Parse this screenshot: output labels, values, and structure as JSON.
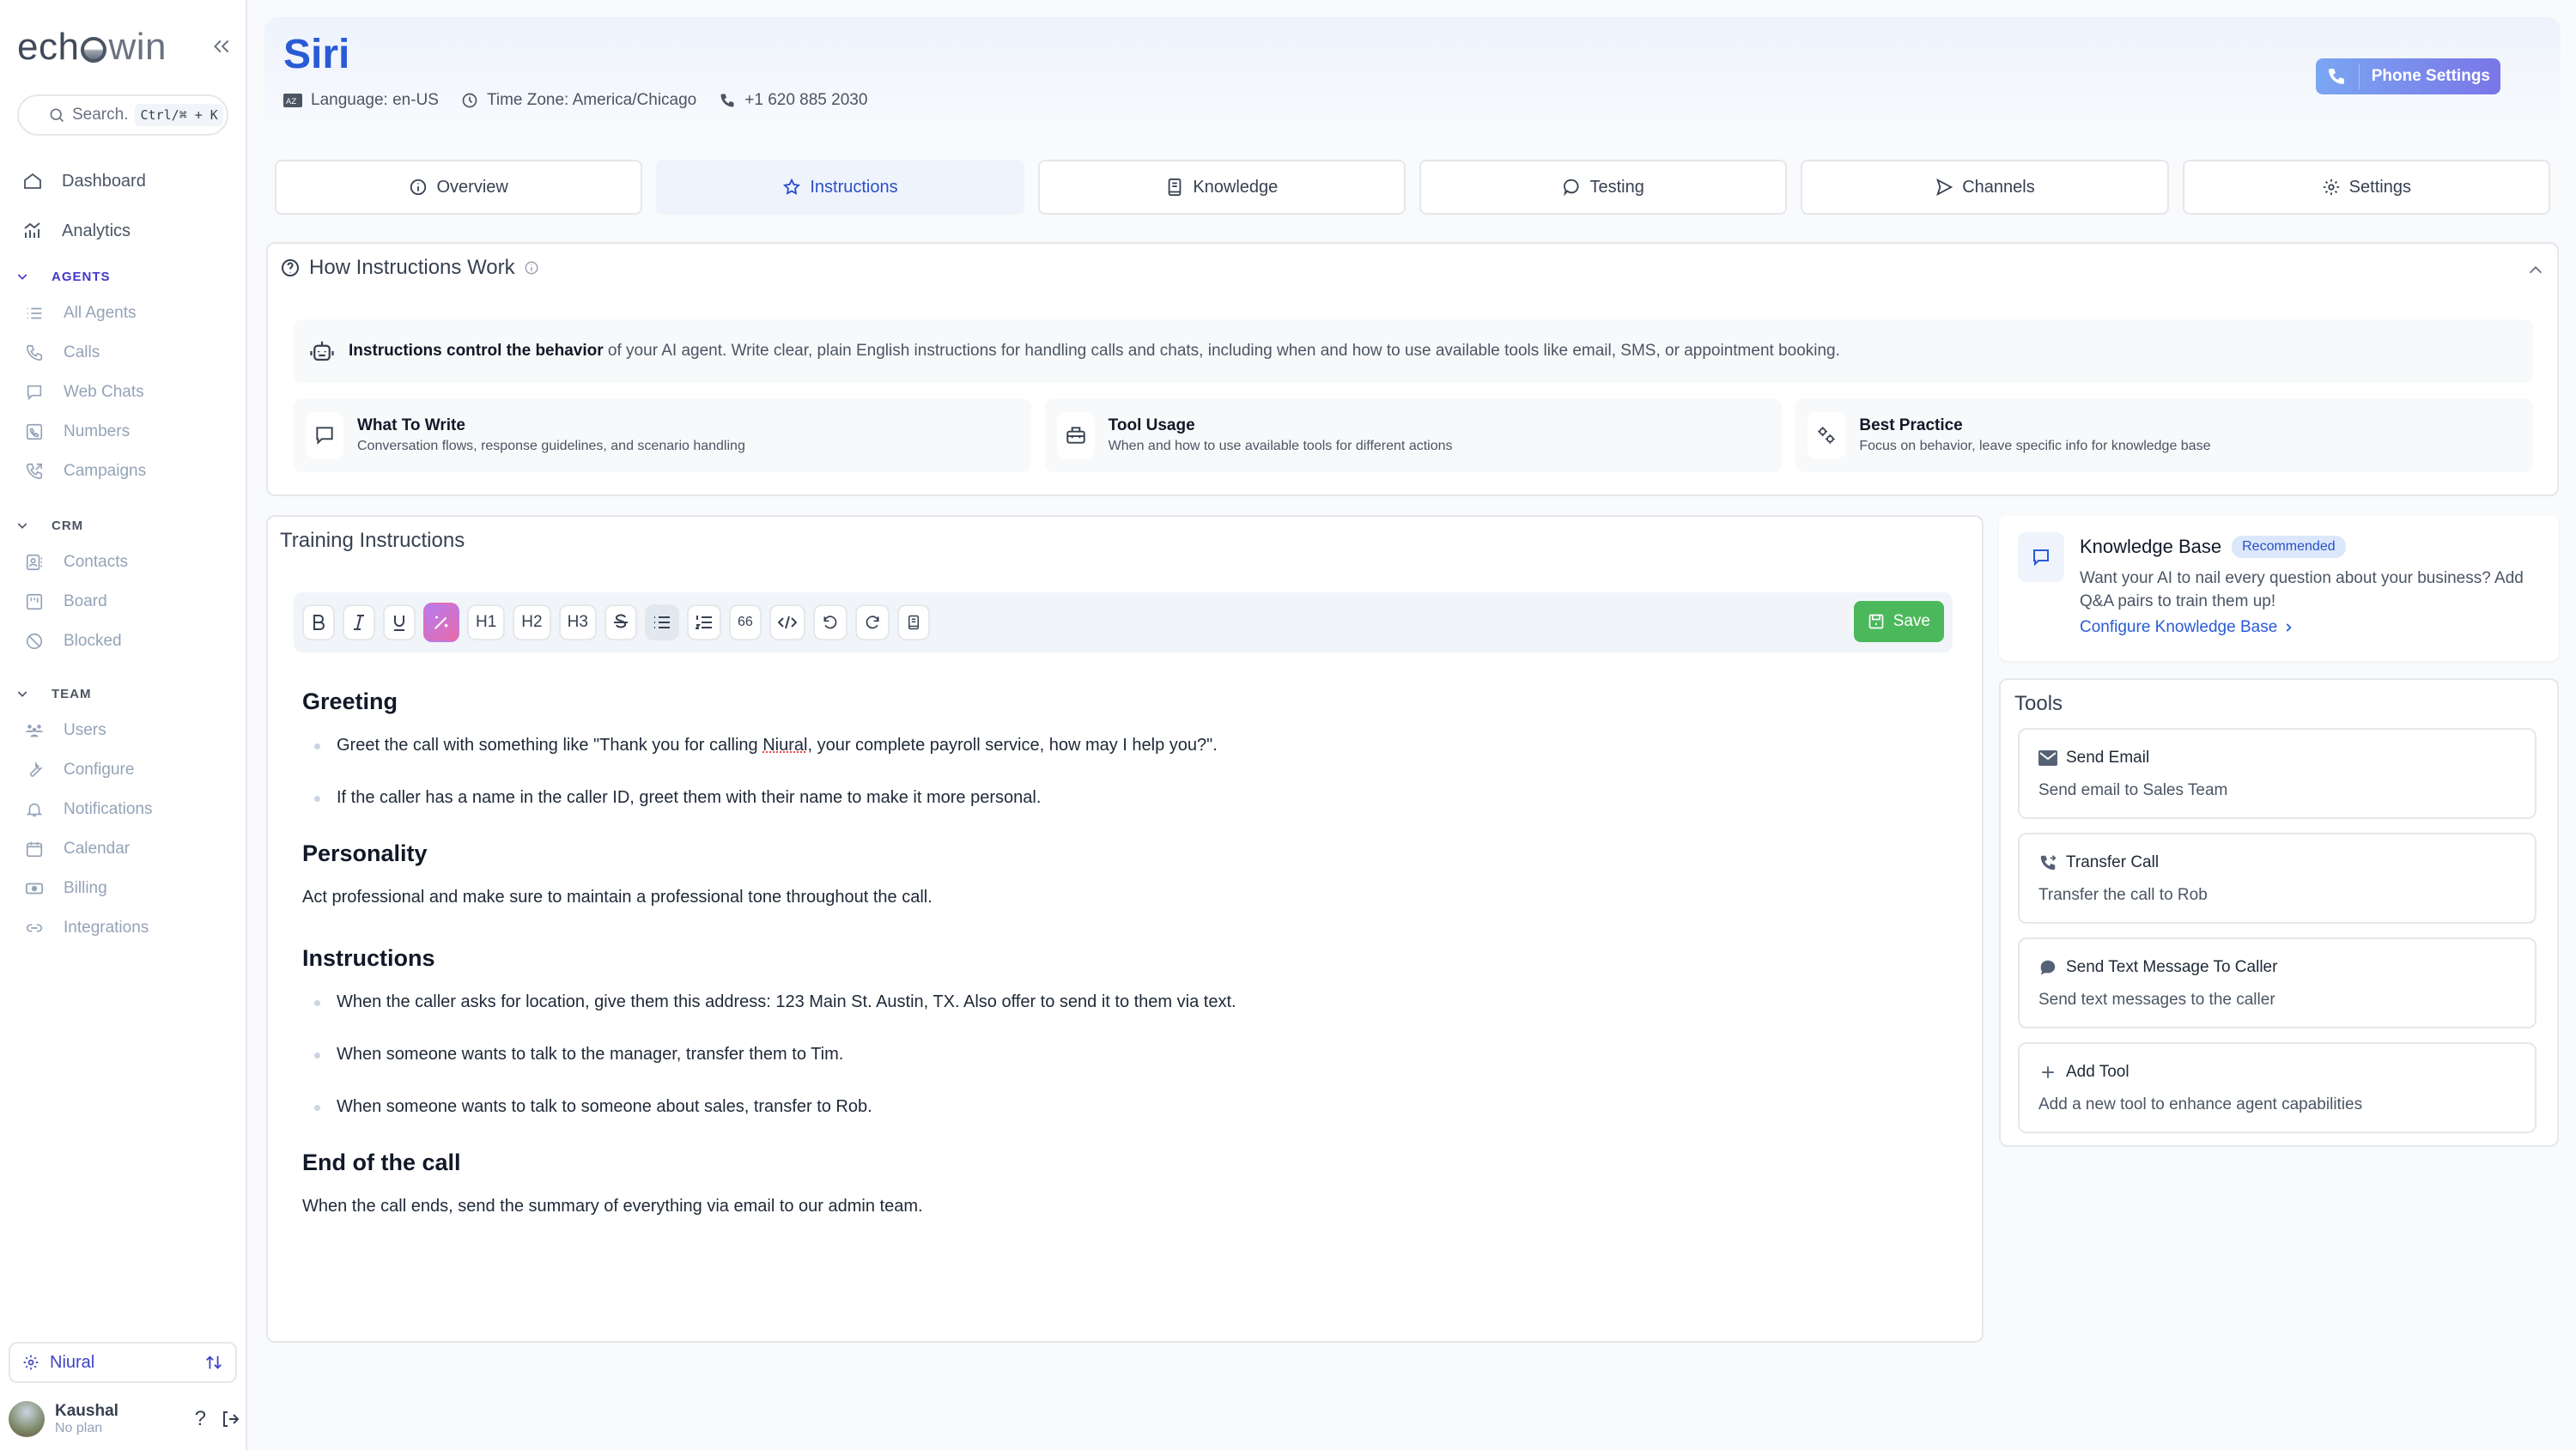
{
  "app": {
    "logo_prefix": "ech",
    "logo_suffix": "win"
  },
  "sidebar": {
    "search_placeholder": "Search.",
    "search_shortcut": "Ctrl/⌘ + K",
    "top_items": [
      {
        "label": "Dashboard",
        "icon": "home-icon"
      },
      {
        "label": "Analytics",
        "icon": "analytics-icon"
      }
    ],
    "sections": [
      {
        "title": "AGENTS",
        "items": [
          "All Agents",
          "Calls",
          "Web Chats",
          "Numbers",
          "Campaigns"
        ]
      },
      {
        "title": "CRM",
        "items": [
          "Contacts",
          "Board",
          "Blocked"
        ]
      },
      {
        "title": "TEAM",
        "items": [
          "Users",
          "Configure",
          "Notifications",
          "Calendar",
          "Billing",
          "Integrations"
        ]
      }
    ],
    "org_name": "Niural",
    "user": {
      "name": "Kaushal",
      "plan": "No plan"
    }
  },
  "header": {
    "title": "Siri",
    "language": "Language: en-US",
    "timezone": "Time Zone: America/Chicago",
    "phone": "+1 620 885 2030",
    "phone_settings_label": "Phone Settings"
  },
  "tabs": [
    {
      "label": "Overview",
      "active": false
    },
    {
      "label": "Instructions",
      "active": true
    },
    {
      "label": "Knowledge",
      "active": false
    },
    {
      "label": "Testing",
      "active": false
    },
    {
      "label": "Channels",
      "active": false
    },
    {
      "label": "Settings",
      "active": false
    }
  ],
  "how": {
    "title": "How Instructions Work",
    "banner_bold": "Instructions control the behavior",
    "banner_rest": " of your AI agent. Write clear, plain English instructions for handling calls and chats, including when and how to use available tools like email, SMS, or appointment booking.",
    "cards": [
      {
        "title": "What To Write",
        "desc": "Conversation flows, response guidelines, and scenario handling"
      },
      {
        "title": "Tool Usage",
        "desc": "When and how to use available tools for different actions"
      },
      {
        "title": "Best Practice",
        "desc": "Focus on behavior, leave specific info for knowledge base"
      }
    ]
  },
  "training": {
    "title": "Training Instructions",
    "toolbar": {
      "h1": "H1",
      "h2": "H2",
      "h3": "H3",
      "quote": "66",
      "save_label": "Save"
    },
    "content": {
      "greeting_heading": "Greeting",
      "greeting_1_pre": "Greet the call with something like \"Thank you for calling ",
      "greeting_1_word": "Niural",
      "greeting_1_post": ", your complete payroll service, how may I help you?\".",
      "greeting_2": "If the caller has a name in the caller ID, greet them with their name to make it more personal.",
      "personality_heading": "Personality",
      "personality_text": "Act professional and make sure to maintain a professional tone throughout the call.",
      "instructions_heading": "Instructions",
      "instructions": [
        "When the caller asks for location, give them this address: 123 Main St. Austin, TX. Also offer to send it to them via text.",
        "When someone wants to talk to the manager, transfer them to Tim.",
        "When someone wants to talk to someone about sales, transfer to Rob."
      ],
      "end_heading": "End of the call",
      "end_text": "When the call ends, send the summary of everything via email to our admin team."
    }
  },
  "knowledge_base": {
    "title": "Knowledge Base",
    "badge": "Recommended",
    "desc": "Want your AI to nail every question about your business? Add Q&A pairs to train them up!",
    "link": "Configure Knowledge Base"
  },
  "tools": {
    "title": "Tools",
    "items": [
      {
        "title": "Send Email",
        "desc": "Send email to Sales Team"
      },
      {
        "title": "Transfer Call",
        "desc": "Transfer the call to Rob"
      },
      {
        "title": "Send Text Message To Caller",
        "desc": "Send text messages to the caller"
      },
      {
        "title": "Add Tool",
        "desc": "Add a new tool to enhance agent capabilities"
      }
    ]
  },
  "colors": {
    "brand_blue": "#2a5bd7",
    "save_green": "#4cb85c",
    "active_section": "#4338ca"
  }
}
